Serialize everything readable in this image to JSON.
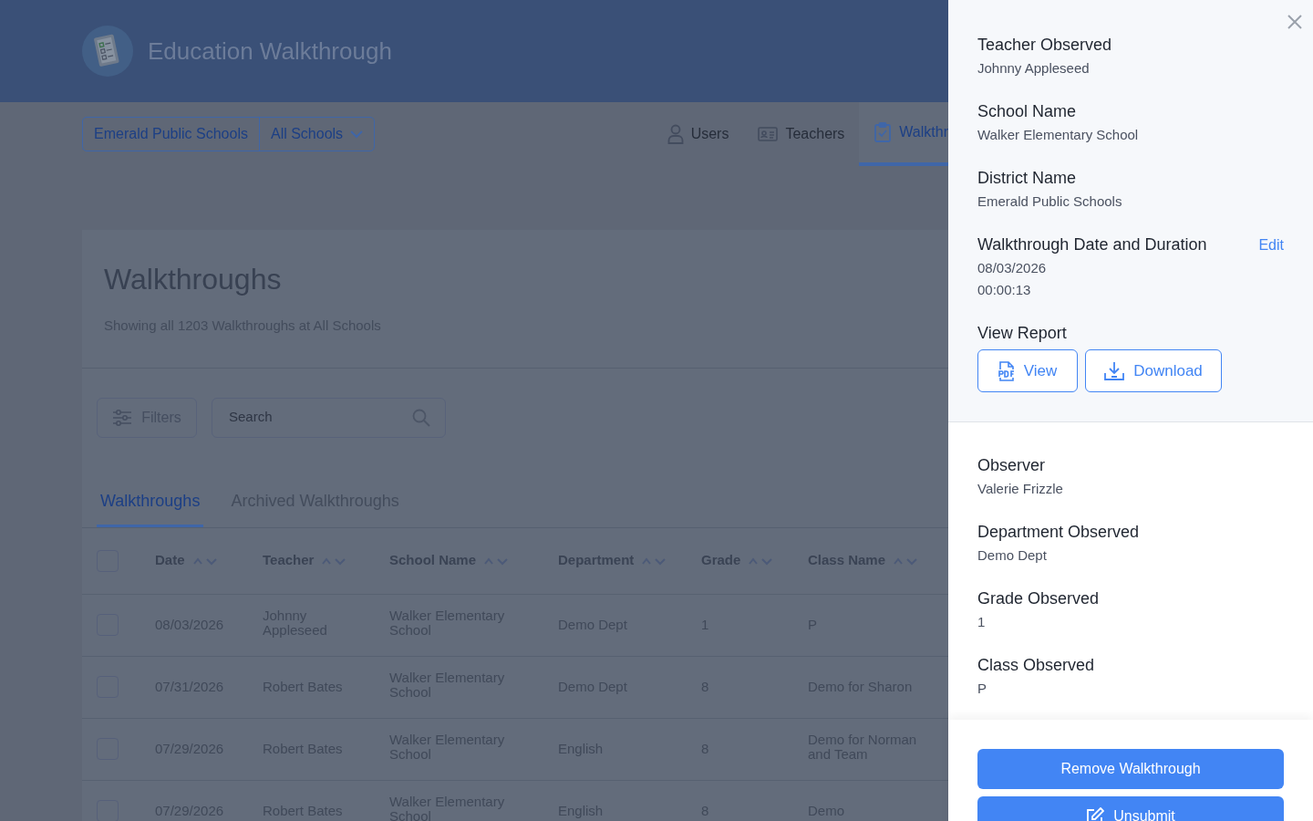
{
  "header": {
    "app_title": "Education Walkthrough"
  },
  "org_selector": {
    "district": "Emerald Public Schools",
    "school": "All Schools"
  },
  "nav_tabs": [
    {
      "label": "Users",
      "selected": false
    },
    {
      "label": "Teachers",
      "selected": false
    },
    {
      "label": "Walkthr",
      "selected": true
    }
  ],
  "page": {
    "title": "Walkthroughs",
    "subtitle": "Showing all 1203 Walkthroughs at All Schools"
  },
  "toolbar": {
    "filters_label": "Filters",
    "search_placeholder": "Search"
  },
  "list_tabs": [
    {
      "label": "Walkthroughs",
      "selected": true
    },
    {
      "label": "Archived Walkthroughs",
      "selected": false
    }
  ],
  "table": {
    "select_all_checked": false,
    "columns": [
      "Date",
      "Teacher",
      "School Name",
      "Department",
      "Grade",
      "Class Name"
    ],
    "rows": [
      {
        "checked": false,
        "cells": [
          "08/03/2026",
          "Johnny Appleseed",
          "Walker Elementary School",
          "Demo Dept",
          "1",
          "P"
        ]
      },
      {
        "checked": false,
        "cells": [
          "07/31/2026",
          "Robert Bates",
          "Walker Elementary School",
          "Demo Dept",
          "8",
          "Demo for Sharon"
        ]
      },
      {
        "checked": false,
        "cells": [
          "07/29/2026",
          "Robert Bates",
          "Walker Elementary School",
          "English",
          "8",
          "Demo for Norman and Team"
        ]
      },
      {
        "checked": false,
        "cells": [
          "07/29/2026",
          "Robert Bates",
          "Walker Elementary School",
          "English",
          "8",
          "Demo"
        ]
      }
    ]
  },
  "drawer": {
    "summary": [
      {
        "label": "Teacher Observed",
        "values": [
          "Johnny Appleseed"
        ]
      },
      {
        "label": "School Name",
        "values": [
          "Walker Elementary School"
        ]
      },
      {
        "label": "District Name",
        "values": [
          "Emerald Public Schools"
        ]
      },
      {
        "label": "Walkthrough Date and Duration",
        "values": [
          "08/03/2026",
          "00:00:13"
        ],
        "action": "Edit"
      }
    ],
    "report": {
      "label": "View Report",
      "buttons": [
        {
          "label": "View",
          "kind": "pdf"
        },
        {
          "label": "Download",
          "kind": "download"
        }
      ]
    },
    "details": [
      {
        "label": "Observer",
        "values": [
          "Valerie Frizzle"
        ]
      },
      {
        "label": "Department Observed",
        "values": [
          "Demo Dept"
        ]
      },
      {
        "label": "Grade Observed",
        "values": [
          "1"
        ]
      },
      {
        "label": "Class Observed",
        "values": [
          "P"
        ]
      }
    ],
    "actions": [
      {
        "label": "Remove Walkthrough",
        "kind": "plain"
      },
      {
        "label": "Unsubmit",
        "kind": "edit"
      }
    ]
  }
}
